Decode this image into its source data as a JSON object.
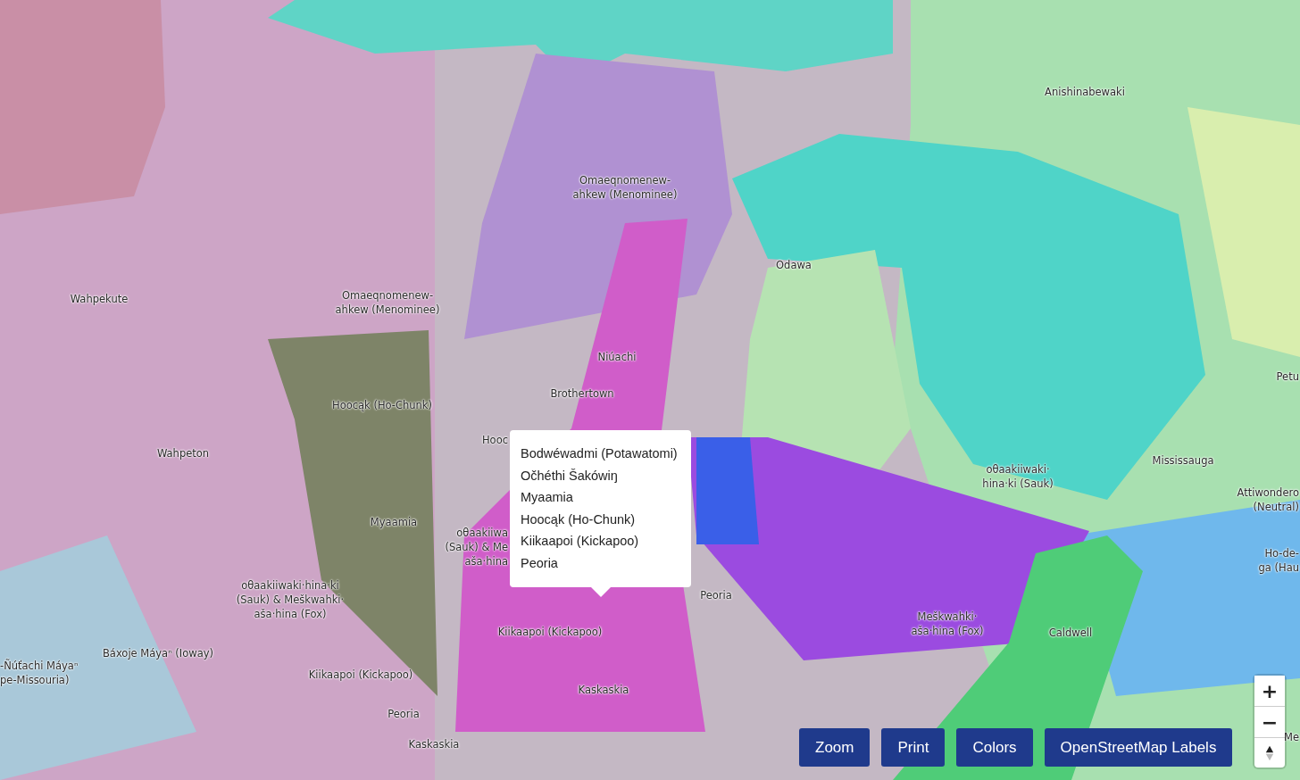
{
  "map_labels": [
    {
      "lines": [
        "Anishinabewaki"
      ]
    },
    {
      "lines": [
        "Omaeqnomenew-",
        "ahkew (Menominee)"
      ]
    },
    {
      "lines": [
        "Odawa"
      ]
    },
    {
      "lines": [
        "Wahpekute"
      ]
    },
    {
      "lines": [
        "Omaeqnomenew-",
        "ahkew (Menominee)"
      ]
    },
    {
      "lines": [
        "Niúachi"
      ]
    },
    {
      "lines": [
        "Petu"
      ]
    },
    {
      "lines": [
        "Brothertown"
      ]
    },
    {
      "lines": [
        "Hoocąk (Ho-Chunk)"
      ]
    },
    {
      "lines": [
        "Hooc"
      ]
    },
    {
      "lines": [
        "Wahpeton"
      ]
    },
    {
      "lines": [
        "Mississauga"
      ]
    },
    {
      "lines": [
        "oθaakiiwaki·",
        "hina·ki (Sauk)"
      ]
    },
    {
      "lines": [
        "Attiwondero",
        "(Neutral)"
      ]
    },
    {
      "lines": [
        "Myaamia"
      ]
    },
    {
      "lines": [
        "oθaakiiwa",
        "(Sauk) & Me",
        "aša·hina"
      ]
    },
    {
      "lines": [
        "Ho-de-",
        "ga (Hau"
      ]
    },
    {
      "lines": [
        "oθaakiiwaki·hina·ki",
        "(Sauk) & Meškwahki·",
        "aša·hina (Fox)"
      ]
    },
    {
      "lines": [
        "Peoria"
      ]
    },
    {
      "lines": [
        "Kiikaapoi (Kickapoo)"
      ]
    },
    {
      "lines": [
        "Meškwahki·",
        "aša·hina (Fox)"
      ]
    },
    {
      "lines": [
        "Caldwell"
      ]
    },
    {
      "lines": [
        "Báxoje Máyaⁿ (Ioway)"
      ]
    },
    {
      "lines": [
        "-Ñúťachi Máyaⁿ",
        "pe-Missouria)"
      ]
    },
    {
      "lines": [
        "Kiikaapoi (Kickapoo)"
      ]
    },
    {
      "lines": [
        "Kaskaskia"
      ]
    },
    {
      "lines": [
        "Peoria"
      ]
    },
    {
      "lines": [
        "Kaskaskia"
      ]
    },
    {
      "lines": [
        "Me"
      ]
    }
  ],
  "popup": {
    "items": [
      "Bodwéwadmi (Potawatomi)",
      "Očhéthi Šakówiŋ",
      "Myaamia",
      "Hoocąk (Ho-Chunk)",
      "Kiikaapoi (Kickapoo)",
      "Peoria"
    ]
  },
  "buttons": [
    "Zoom",
    "Print",
    "Colors",
    "OpenStreetMap Labels"
  ],
  "zoom_control": {
    "zoom_in": "+",
    "zoom_out": "−"
  }
}
